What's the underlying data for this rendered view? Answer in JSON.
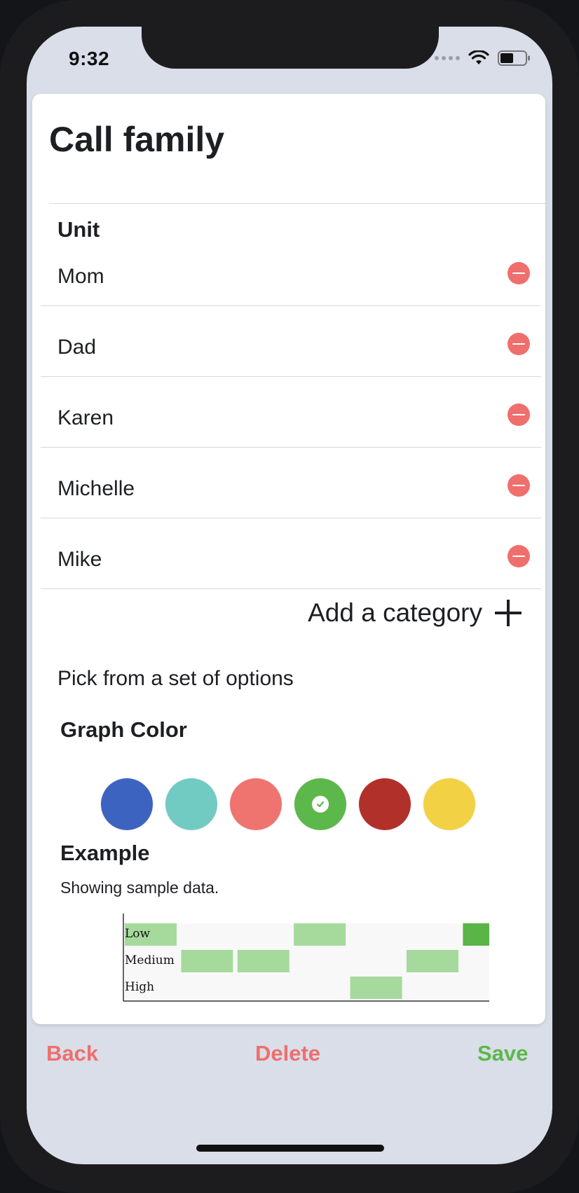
{
  "status": {
    "time": "9:32"
  },
  "title": "Call family",
  "unit_label": "Unit",
  "units": [
    {
      "label": "Mom"
    },
    {
      "label": "Dad"
    },
    {
      "label": "Karen"
    },
    {
      "label": "Michelle"
    },
    {
      "label": "Mike"
    }
  ],
  "add_category_label": "Add a category",
  "pick_text": "Pick from a set of options",
  "graph_color": {
    "label": "Graph Color",
    "swatches": [
      "#3d63c0",
      "#72cbc2",
      "#ef7470",
      "#5cb84a",
      "#b2302a",
      "#f3d145"
    ],
    "selected_index": 3
  },
  "example": {
    "label": "Example",
    "subtitle": "Showing sample data."
  },
  "chart_data": {
    "type": "heatmap",
    "row_labels": [
      "Low",
      "Medium",
      "High"
    ],
    "columns": 7,
    "cells": [
      {
        "column": 1,
        "row": "Low",
        "highlight": false
      },
      {
        "column": 2,
        "row": "Medium",
        "highlight": false
      },
      {
        "column": 3,
        "row": "Medium",
        "highlight": false
      },
      {
        "column": 4,
        "row": "Low",
        "highlight": false
      },
      {
        "column": 5,
        "row": "High",
        "highlight": false
      },
      {
        "column": 6,
        "row": "Medium",
        "highlight": false
      },
      {
        "column": 7,
        "row": "Low",
        "highlight": true
      }
    ],
    "colors": {
      "cell": "#a5da9c",
      "highlight": "#5ab447",
      "background": "#f8f8f8"
    }
  },
  "bottom": {
    "back": "Back",
    "delete": "Delete",
    "save": "Save",
    "back_color": "#ee6f6c",
    "delete_color": "#ee6f6c",
    "save_color": "#5cb84a"
  }
}
